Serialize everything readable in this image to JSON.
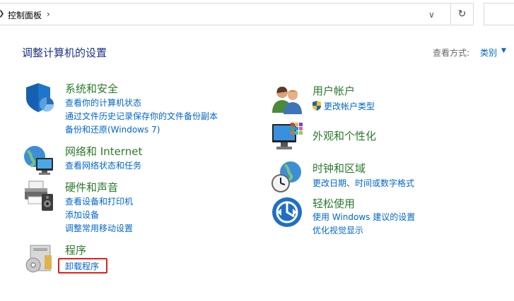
{
  "addressbar": {
    "breadcrumb": "控制面板",
    "dropdown_icon": "chevron-down-icon",
    "refresh_icon": "refresh-icon"
  },
  "header": {
    "title": "调整计算机的设置",
    "view_by_label": "查看方式:",
    "view_by_value": "类别"
  },
  "categories_left": [
    {
      "title": "系统和安全",
      "icon": "shield-icon",
      "links": [
        "查看你的计算机状态",
        "通过文件历史记录保存你的文件备份副本",
        "备份和还原(Windows 7)"
      ]
    },
    {
      "title": "网络和 Internet",
      "icon": "network-globe-icon",
      "links": [
        "查看网络状态和任务"
      ]
    },
    {
      "title": "硬件和声音",
      "icon": "printer-speaker-icon",
      "links": [
        "查看设备和打印机",
        "添加设备",
        "调整常用移动设置"
      ]
    },
    {
      "title": "程序",
      "icon": "programs-disc-icon",
      "links": [
        "卸载程序"
      ]
    }
  ],
  "categories_right": [
    {
      "title": "用户帐户",
      "icon": "users-icon",
      "links": [
        "更改帐户类型"
      ]
    },
    {
      "title": "外观和个性化",
      "icon": "monitor-palette-icon",
      "links": []
    },
    {
      "title": "时钟和区域",
      "icon": "clock-globe-icon",
      "links": [
        "更改日期、时间或数字格式"
      ]
    },
    {
      "title": "轻松使用",
      "icon": "accessibility-icon",
      "links": [
        "使用 Windows 建议的设置",
        "优化视觉显示"
      ]
    }
  ],
  "colors": {
    "link": "#0066cc",
    "category_title": "#2b7a2b",
    "page_title": "#1e3287",
    "highlight_box": "#e0201b"
  }
}
